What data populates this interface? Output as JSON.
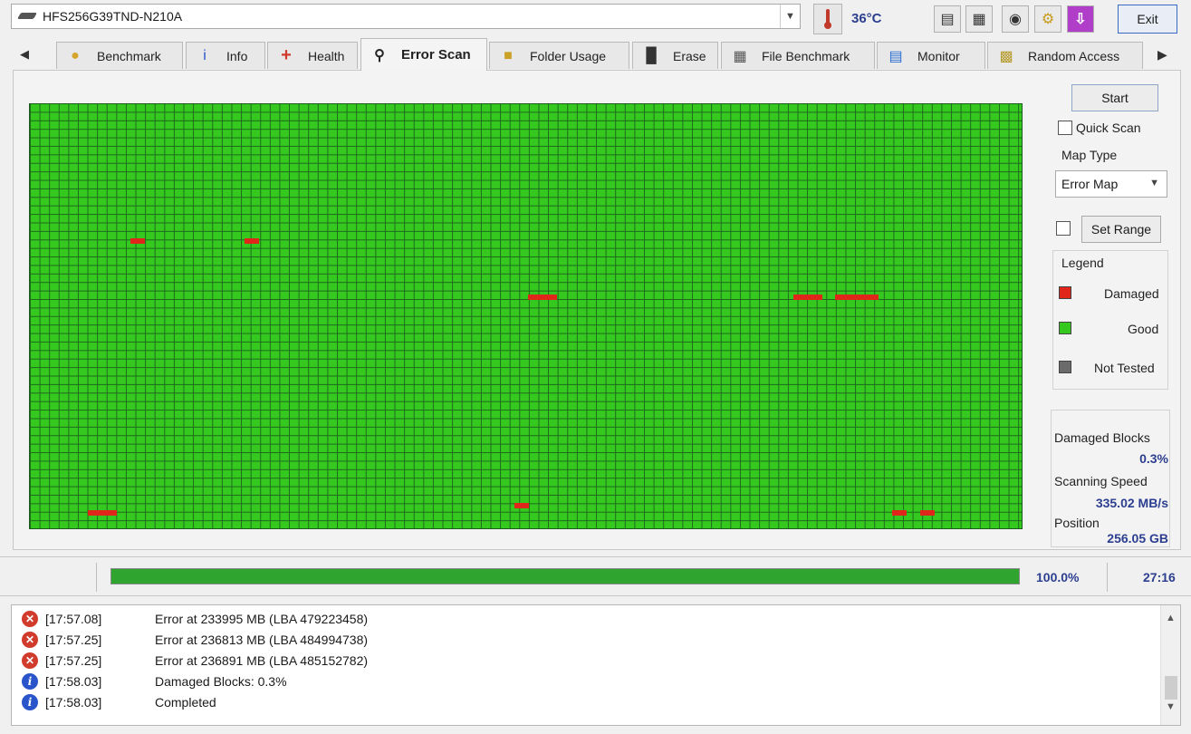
{
  "drive": {
    "name": "HFS256G39TND-N210A"
  },
  "temperature": {
    "value": "36°C"
  },
  "toolbar": {
    "buttons": [
      {
        "name": "copy-text-icon"
      },
      {
        "name": "copy-report-icon"
      },
      {
        "name": "screenshot-icon"
      },
      {
        "name": "options-icon"
      },
      {
        "name": "download-icon"
      }
    ],
    "exit_label": "Exit"
  },
  "tabs": [
    {
      "label": "Benchmark",
      "icon": "lightbulb-icon"
    },
    {
      "label": "Info",
      "icon": "info-icon"
    },
    {
      "label": "Health",
      "icon": "health-cross-icon"
    },
    {
      "label": "Error Scan",
      "icon": "magnifier-icon",
      "active": true
    },
    {
      "label": "Folder Usage",
      "icon": "folder-icon"
    },
    {
      "label": "Erase",
      "icon": "trash-icon"
    },
    {
      "label": "File Benchmark",
      "icon": "file-benchmark-icon"
    },
    {
      "label": "Monitor",
      "icon": "monitor-chart-icon"
    },
    {
      "label": "Random Access",
      "icon": "random-access-icon"
    }
  ],
  "controls": {
    "start_label": "Start",
    "quick_scan_label": "Quick Scan",
    "map_type_label": "Map Type",
    "map_type_value": "Error Map",
    "set_range_label": "Set Range"
  },
  "legend": {
    "title": "Legend",
    "damaged": "Damaged",
    "good": "Good",
    "not_tested": "Not Tested",
    "colors": {
      "damaged": "#e0261a",
      "good": "#35c81e",
      "not_tested": "#6b6b6b"
    }
  },
  "stats": {
    "damaged_blocks_label": "Damaged Blocks",
    "damaged_blocks_value": "0.3%",
    "scanning_speed_label": "Scanning Speed",
    "scanning_speed_value": "335.02 MB/s",
    "position_label": "Position",
    "position_value": "256.05 GB"
  },
  "progress": {
    "fraction": 1.0,
    "percent_text": "100.0%",
    "elapsed": "27:16"
  },
  "log": [
    {
      "type": "error",
      "time": "[17:57.08]",
      "message": "Error at 233995 MB (LBA 479223458)"
    },
    {
      "type": "error",
      "time": "[17:57.25]",
      "message": "Error at 236813 MB (LBA 484994738)"
    },
    {
      "type": "error",
      "time": "[17:57.25]",
      "message": "Error at 236891 MB (LBA 485152782)"
    },
    {
      "type": "info",
      "time": "[17:58.03]",
      "message": "Damaged Blocks: 0.3%"
    },
    {
      "type": "info",
      "time": "[17:58.03]",
      "message": "Completed"
    }
  ]
}
